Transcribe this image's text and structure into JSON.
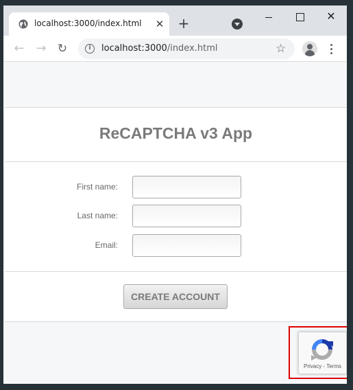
{
  "browser": {
    "tab_title": "localhost:3000/index.html",
    "close_glyph": "✕",
    "new_tab_glyph": "+",
    "url_host": "localhost:3000",
    "url_path": "/index.html",
    "nav": {
      "back_glyph": "←",
      "forward_glyph": "→",
      "reload_glyph": "↻",
      "star_glyph": "☆",
      "info_glyph": "i",
      "window_close_glyph": "✕"
    }
  },
  "app": {
    "title": "ReCAPTCHA v3 App",
    "fields": [
      {
        "label": "First name:",
        "value": ""
      },
      {
        "label": "Last name:",
        "value": ""
      },
      {
        "label": "Email:",
        "value": ""
      }
    ],
    "submit_label": "CREATE ACCOUNT"
  },
  "recaptcha": {
    "privacy_label": "Privacy",
    "separator": " - ",
    "terms_label": "Terms"
  },
  "colors": {
    "highlight": "#e00000",
    "recaptcha_blue": "#4285f4",
    "recaptcha_dark_blue": "#1c3aa9",
    "recaptcha_gray": "#ababab"
  }
}
